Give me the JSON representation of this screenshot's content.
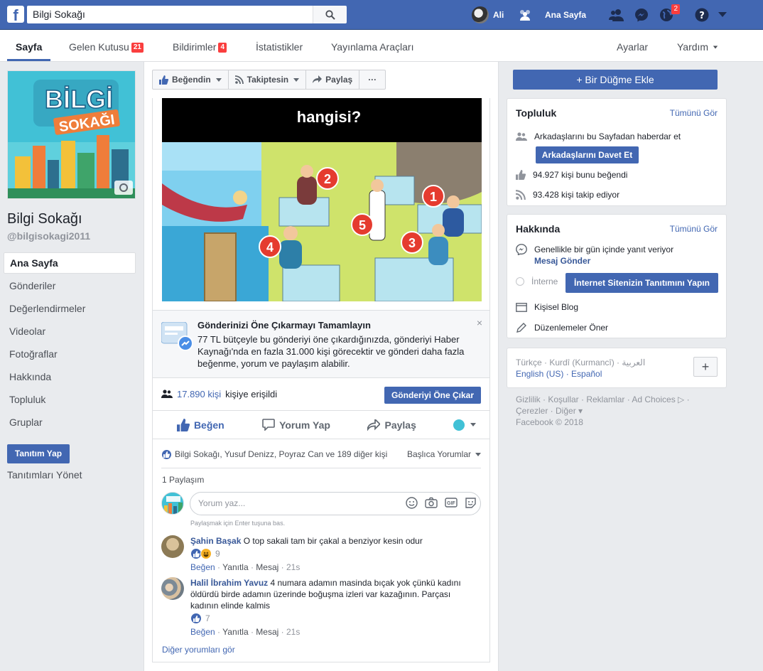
{
  "topbar": {
    "search_value": "Bilgi Sokağı",
    "user_name": "Ali",
    "home_label": "Ana Sayfa",
    "notifications_count": "2"
  },
  "subnav": {
    "page_tab": "Sayfa",
    "inbox_label": "Gelen Kutusu",
    "inbox_count": "21",
    "notifications_label": "Bildirimler",
    "notifications_count": "4",
    "insights_label": "İstatistikler",
    "publishing_label": "Yayınlama Araçları",
    "settings_label": "Ayarlar",
    "help_label": "Yardım"
  },
  "page": {
    "cover_title_1": "BİLGİ",
    "cover_title_2": "SOKAĞI",
    "name": "Bilgi Sokağı",
    "handle": "@bilgisokagi2011"
  },
  "left_menu": {
    "items": [
      "Ana Sayfa",
      "Gönderiler",
      "Değerlendirmeler",
      "Videolar",
      "Fotoğraflar",
      "Hakkında",
      "Topluluk",
      "Gruplar"
    ],
    "promote_label": "Tanıtım Yap",
    "manage_promotions_label": "Tanıtımları Yönet"
  },
  "action_bar": {
    "liked_label": "Beğendin",
    "following_label": "Takiptesin",
    "share_label": "Paylaş",
    "more_label": "···",
    "add_button_label": "+ Bir Düğme Ekle"
  },
  "post": {
    "image_caption": "hangisi?",
    "image_numbers": [
      "1",
      "2",
      "3",
      "4",
      "5"
    ],
    "boost_title": "Gönderinizi Öne Çıkarmayı Tamamlayın",
    "boost_text": "77 TL bütçeyle bu gönderiyi öne çıkardığınızda, gönderiyi Haber Kaynağı'nda en fazla 31.000 kişi görecektir ve gönderi daha fazla beğenme, yorum ve paylaşım alabilir.",
    "reach_number": "17.890 kişi",
    "reach_suffix": "kişiye erişildi",
    "boost_button": "Gönderiyi Öne Çıkar",
    "like_action": "Beğen",
    "comment_action": "Yorum Yap",
    "share_action": "Paylaş",
    "likers_text": "Bilgi Sokağı, Yusuf Denizz, Poyraz Can ve 189 diğer kişi",
    "sort_label": "Başlıca Yorumlar",
    "shares_text": "1 Paylaşım",
    "comment_placeholder": "Yorum yaz...",
    "enter_hint": "Paylaşmak için Enter tuşuna bas.",
    "more_comments": "Diğer yorumları gör"
  },
  "comments": [
    {
      "author": "Şahin Başak",
      "text": "O top sakali tam bir çakal a benziyor kesin odur",
      "reactions": "9",
      "like": "Beğen",
      "reply": "Yanıtla",
      "message": "Mesaj",
      "time": "21s"
    },
    {
      "author": "Halil İbrahim Yavuz",
      "text": "4 numara adamın masinda bıçak yok çünkü kadını öldürdü birde adamın üzerinde boğuşma izleri var kazağının. Parçası kadının elinde kalmis",
      "reactions": "7",
      "like": "Beğen",
      "reply": "Yanıtla",
      "message": "Mesaj",
      "time": "21s"
    }
  ],
  "community": {
    "title": "Topluluk",
    "see_all": "Tümünü Gör",
    "invite_text": "Arkadaşlarını bu Sayfadan haberdar et",
    "invite_button": "Arkadaşlarını Davet Et",
    "likes_text": "94.927 kişi bunu beğendi",
    "followers_text": "93.428 kişi takip ediyor"
  },
  "about": {
    "title": "Hakkında",
    "see_all": "Tümünü Gör",
    "response_text": "Genellikle bir gün içinde yanıt veriyor",
    "send_message": "Mesaj Gönder",
    "internet_label": "İnterne",
    "promote_site_button": "İnternet Sitenizin Tanıtımını Yapın",
    "category": "Kişisel Blog",
    "suggest_edits": "Düzenlemeler Öner"
  },
  "languages": {
    "line1": "Türkçe · Kurdî (Kurmancî) · العربية",
    "line2": "English (US) · Español",
    "add_label": "+"
  },
  "footer": {
    "line1": "Gizlilik · Koşullar · Reklamlar · Ad Choices ▷ ·",
    "line2": "Çerezler · Diğer ▾",
    "line3": "Facebook © 2018"
  }
}
